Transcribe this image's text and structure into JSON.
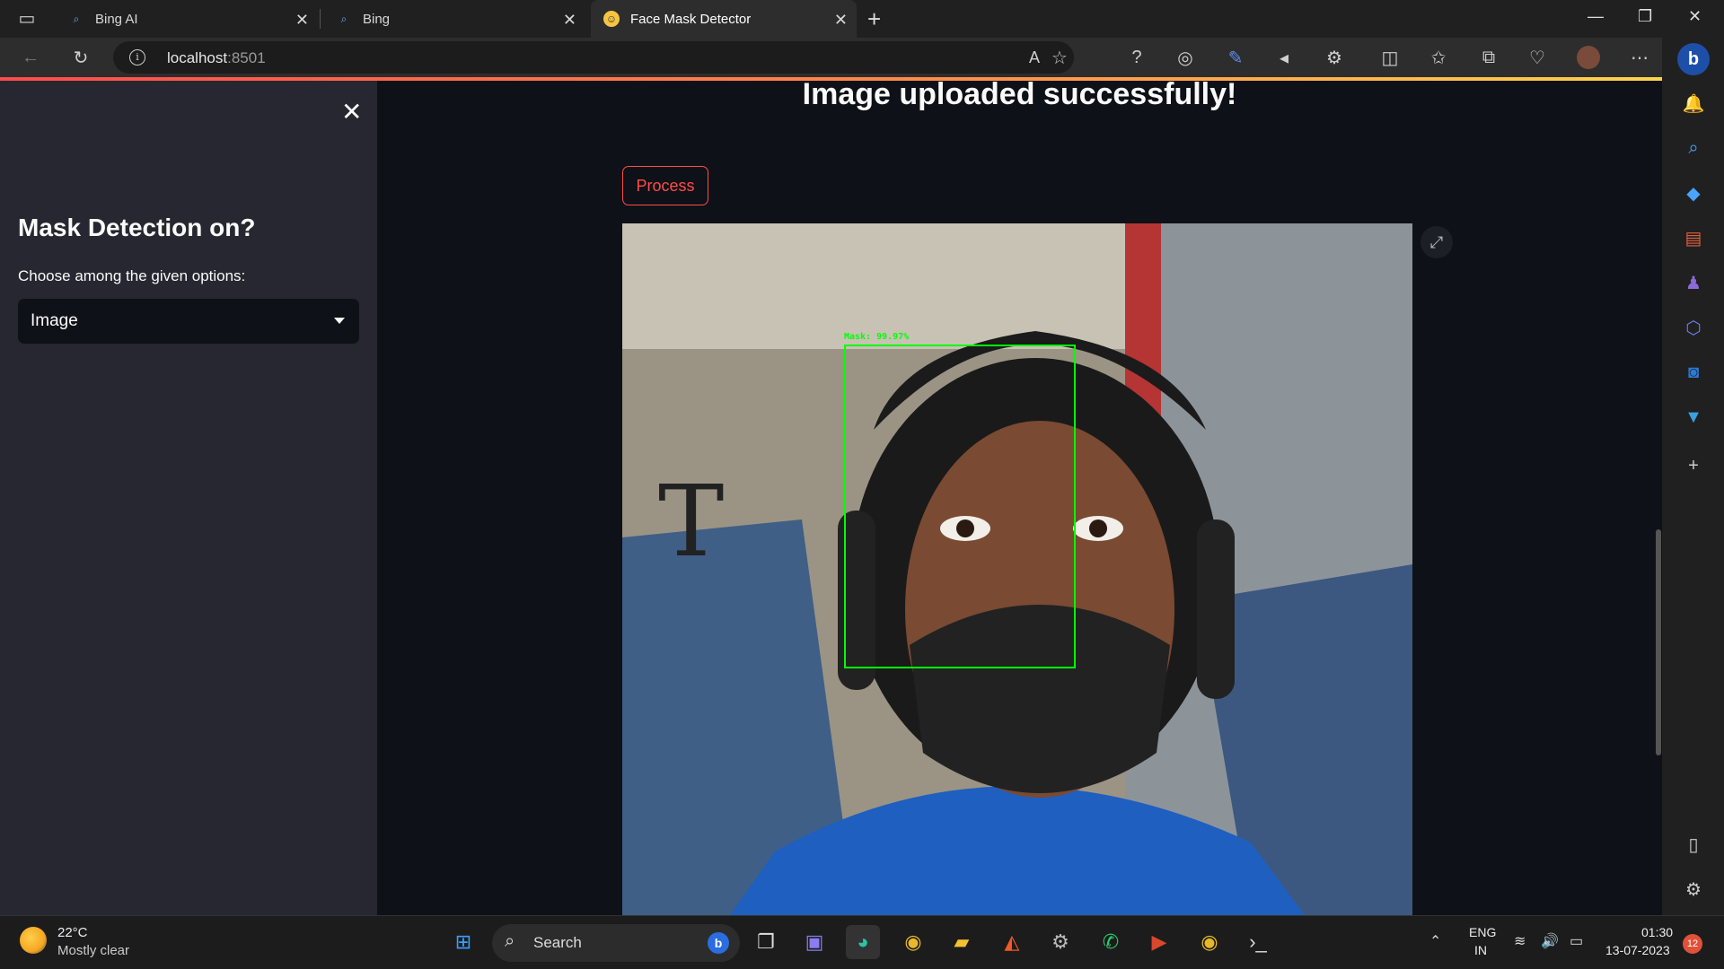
{
  "browser": {
    "tabs": [
      {
        "title": "Bing AI",
        "icon": "search-icon"
      },
      {
        "title": "Bing",
        "icon": "search-icon"
      },
      {
        "title": "Face Mask Detector",
        "icon": "streamlit-icon"
      }
    ],
    "tab_close": "✕",
    "new_tab": "+",
    "address": {
      "host": "localhost",
      "port": ":8501"
    },
    "window_controls": {
      "minimize": "—",
      "restore": "❐",
      "close": "✕"
    }
  },
  "sidebar": {
    "close_label": "✕",
    "title": "Mask Detection on?",
    "select_label": "Choose among the given options:",
    "select_value": "Image"
  },
  "main": {
    "heading": "Image uploaded successfully!",
    "process_button": "Process",
    "detection": {
      "label": "Mask: 99.97%",
      "color": "#00ff00"
    }
  },
  "theme": {
    "accent": "#ff4b4b",
    "background": "#0e1117",
    "sidebar_bg": "#262730"
  },
  "taskbar": {
    "weather_temp": "22°C",
    "weather_cond": "Mostly clear",
    "search_placeholder": "Search",
    "lang_top": "ENG",
    "lang_bottom": "IN",
    "time": "01:30",
    "date": "13-07-2023",
    "notifications": "12"
  }
}
